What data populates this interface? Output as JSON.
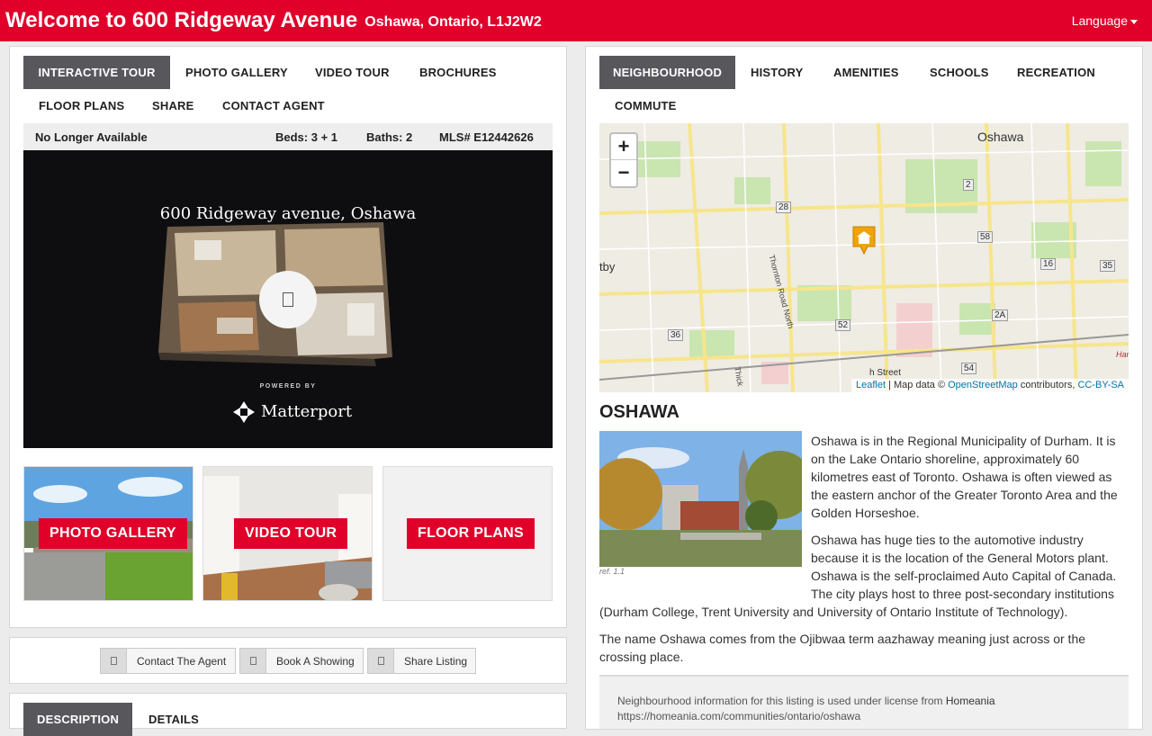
{
  "header": {
    "title": "Welcome to 600 Ridgeway Avenue",
    "subtitle": "Oshawa, Ontario, L1J2W2",
    "language": "Language"
  },
  "left_tabs": [
    "INTERACTIVE TOUR",
    "PHOTO GALLERY",
    "VIDEO TOUR",
    "BROCHURES",
    "FLOOR PLANS",
    "SHARE",
    "CONTACT AGENT"
  ],
  "status": {
    "availability": "No Longer Available",
    "beds": "Beds: 3 + 1",
    "baths": "Baths: 2",
    "mls": "MLS# E12442626"
  },
  "tour": {
    "title": "600 Ridgeway avenue, Oshawa",
    "play_icon": "□",
    "powered_by": "POWERED BY",
    "brand": "Matterport"
  },
  "thumbs": {
    "photo": "PHOTO GALLERY",
    "video": "VIDEO TOUR",
    "floor": "FLOOR PLANS"
  },
  "actions": {
    "contact": "Contact The Agent",
    "showing": "Book A Showing",
    "share": "Share Listing"
  },
  "bottom_tabs": [
    "DESCRIPTION",
    "DETAILS"
  ],
  "right_tabs": [
    "NEIGHBOURHOOD",
    "HISTORY",
    "AMENITIES",
    "SCHOOLS",
    "RECREATION",
    "COMMUTE"
  ],
  "map": {
    "zoom_in": "+",
    "zoom_out": "−",
    "labels": {
      "city": "Oshawa",
      "west": "tby",
      "road": "Thornton Road North",
      "street": "h Street",
      "thick": "Thick",
      "harm": "Har"
    },
    "shields": [
      "28",
      "2",
      "58",
      "16",
      "35",
      "36",
      "52",
      "2A",
      "54"
    ],
    "attribution": {
      "leaflet": "Leaflet",
      "mapdata": "| Map data ©",
      "osm": "OpenStreetMap",
      "contributors": "contributors,",
      "license": "CC-BY-SA"
    }
  },
  "neighbourhood": {
    "city": "OSHAWA",
    "ref": "ref. 1.1",
    "p1": "Oshawa is in the Regional Municipality of Durham. It is on the Lake Ontario shoreline, approximately 60 kilometres east of Toronto. Oshawa is often viewed as the eastern anchor of the Greater Toronto Area and the Golden Horseshoe.",
    "p2": "Oshawa has huge ties to the automotive industry because it is the location of the General Motors plant. Oshawa is the self-proclaimed Auto Capital of Canada. The city plays host to three post-secondary institutions (Durham College, Trent University and University of Ontario Institute of Technology).",
    "p3": "The name Oshawa comes from the Ojibwaa term aazhaway meaning just across or the crossing place.",
    "license_text": "Neighbourhood information for this listing is used under license from",
    "license_src": "Homeania",
    "license_url": "https://homeania.com/communities/ontario/oshawa"
  }
}
